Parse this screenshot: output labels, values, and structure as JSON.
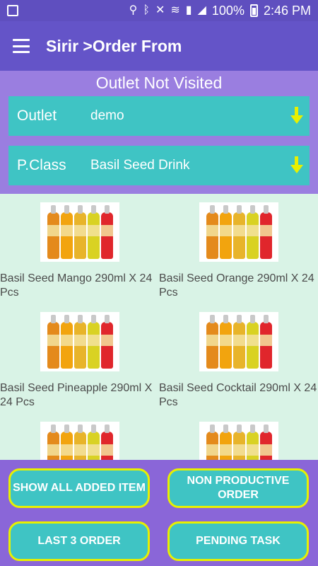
{
  "status_bar": {
    "battery": "100%",
    "time": "2:46 PM"
  },
  "app_bar": {
    "title": "Sirir >Order From"
  },
  "outlet_status": "Outlet Not Visited",
  "selectors": [
    {
      "label": "Outlet",
      "value": "demo"
    },
    {
      "label": "P.Class",
      "value": "Basil Seed Drink"
    }
  ],
  "products": [
    {
      "name": "Basil Seed Mango 290ml X 24 Pcs"
    },
    {
      "name": "Basil Seed Orange 290ml X 24 Pcs"
    },
    {
      "name": "Basil Seed Pineapple 290ml X 24 Pcs"
    },
    {
      "name": "Basil Seed Cocktail 290ml X 24 Pcs"
    },
    {
      "name": ""
    },
    {
      "name": ""
    }
  ],
  "buttons": {
    "show_all": "SHOW ALL ADDED ITEM",
    "non_productive": "NON PRODUCTIVE ORDER",
    "last3": "LAST 3 ORDER",
    "pending": "PENDING TASK"
  },
  "colors": {
    "app_bar": "#6454c8",
    "header_panel": "#9a7ee0",
    "selector": "#3fc4c4",
    "arrow": "#e8f000",
    "grid_bg": "#d9f3e6",
    "bottom_panel": "#8a66d8"
  }
}
